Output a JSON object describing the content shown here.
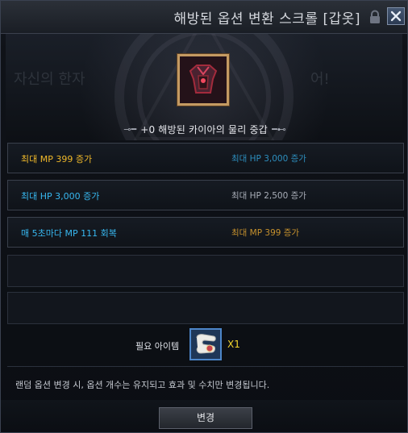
{
  "window": {
    "title": "해방된 옵션 변환 스크롤 [갑옷]",
    "background_hint_left": "자신의 한자",
    "background_hint_right": "어!"
  },
  "item": {
    "name": "+0 해방된 카이아의 물리 중갑",
    "icon": "dark-armor-chestpiece-icon"
  },
  "options": [
    {
      "left": "최대 MP 399 증가",
      "left_color": "#f0b92a",
      "right": "최대 HP 3,000 증가",
      "right_color": "#2d8fbf"
    },
    {
      "left": "최대 HP 3,000 증가",
      "left_color": "#37b7ef",
      "right": "최대 HP 2,500 증가",
      "right_color": "#a9aeb8"
    },
    {
      "left": "매 5초마다 MP 111 회복",
      "left_color": "#37b7ef",
      "right": "최대 MP 399 증가",
      "right_color": "#c6912d"
    }
  ],
  "required": {
    "label": "필요 아이템",
    "item_icon": "option-scroll-icon",
    "quantity": "X1"
  },
  "notice": "랜덤 옵션 변경 시, 옵션 개수는 유지되고 효과 및 수치만 변경됩니다.",
  "buttons": {
    "change": "변경"
  },
  "colors": {
    "accent_blue": "#37b7ef",
    "accent_gold": "#f0b92a",
    "qty_yellow": "#f2d42d"
  }
}
